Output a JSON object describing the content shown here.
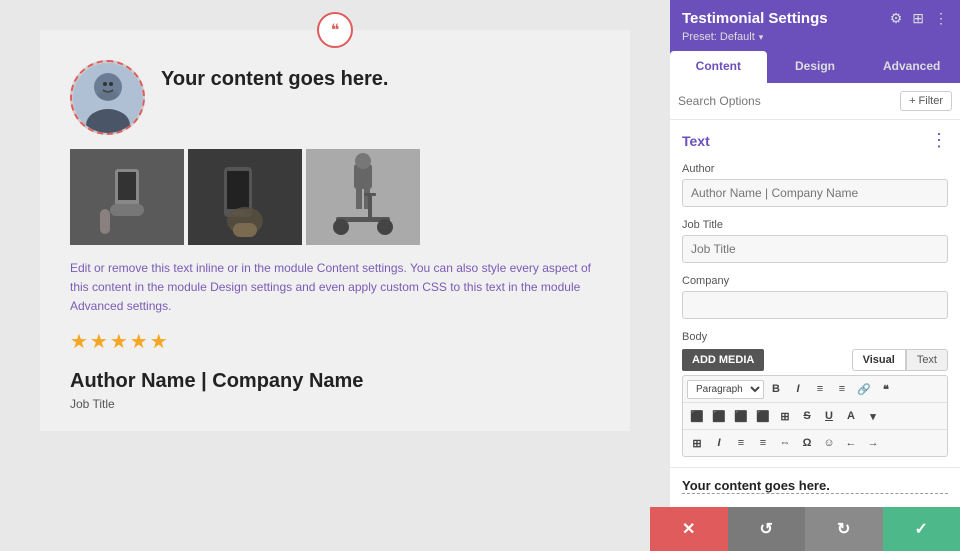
{
  "panel": {
    "title": "Testimonial Settings",
    "preset_label": "Preset: Default",
    "preset_arrow": "▾",
    "tabs": [
      "Content",
      "Design",
      "Advanced"
    ],
    "active_tab": "Content",
    "icons": {
      "settings": "⚙",
      "grid": "⊞",
      "more": "⋮"
    }
  },
  "search": {
    "placeholder": "Search Options",
    "filter_label": "+ Filter"
  },
  "text_section": {
    "label": "Text",
    "more_icon": "⋮"
  },
  "fields": {
    "author_label": "Author",
    "author_placeholder": "Author Name | Company Name",
    "job_title_label": "Job Title",
    "job_title_placeholder": "Job Title",
    "company_label": "Company",
    "company_value": "",
    "body_label": "Body"
  },
  "editor": {
    "add_media": "ADD MEDIA",
    "visual_label": "Visual",
    "text_label": "Text",
    "paragraph_option": "Paragraph",
    "toolbar_buttons": [
      "B",
      "I",
      "≡",
      "≡",
      "🔗",
      "❝"
    ],
    "toolbar_row2": [
      "≡",
      "≡",
      "≡",
      "≡",
      "⊞",
      "S",
      "U",
      "A",
      "▾"
    ],
    "toolbar_row3": [
      "⊞",
      "I",
      "≡",
      "≡",
      "⇔",
      "Ω",
      "☺",
      "←",
      "→"
    ]
  },
  "preview": {
    "snippet_text": "Your content goes here."
  },
  "testimonial": {
    "quote_icon": "❝",
    "content_title": "Your content goes here.",
    "body_text": "Edit or remove this text inline or in the module Content settings. You can also style every aspect of this content in the module Design settings and even apply custom CSS to this text in the module Advanced settings.",
    "stars": "★★★★★",
    "author_name": "Author Name | Company Name",
    "job_title": "Job Title"
  },
  "actions": {
    "cancel_icon": "✕",
    "undo_icon": "↺",
    "redo_icon": "↻",
    "save_icon": "✓"
  }
}
